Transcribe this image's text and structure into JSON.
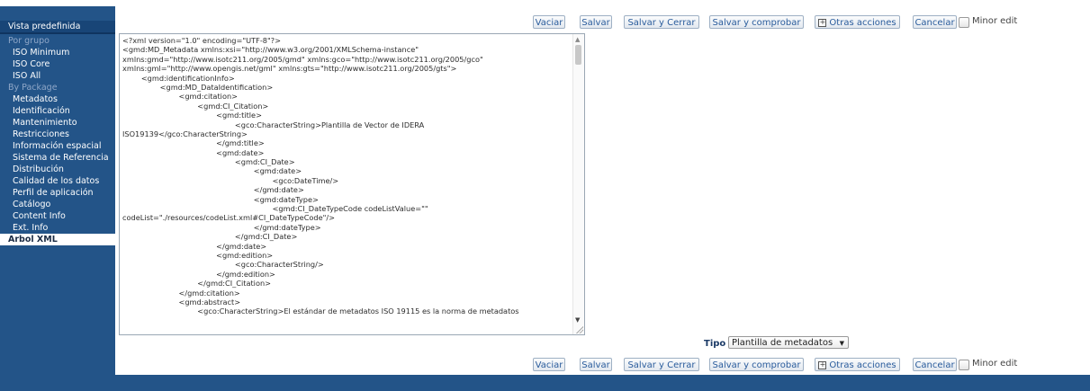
{
  "sidebar": {
    "top_item": "Vista predefinida",
    "group_header": "Por grupo",
    "group_items": [
      "ISO Minimum",
      "ISO Core",
      "ISO All"
    ],
    "package_header": "By Package",
    "package_items": [
      "Metadatos",
      "Identificación",
      "Mantenimiento",
      "Restricciones",
      "Información espacial",
      "Sistema de Referencia",
      "Distribución",
      "Calidad de los datos",
      "Perfil de aplicación",
      "Catálogo",
      "Content Info",
      "Ext. Info"
    ],
    "active_item": "Arbol XML"
  },
  "toolbar": {
    "vaciar": "Vaciar",
    "salvar": "Salvar",
    "salvar_cerrar": "Salvar y Cerrar",
    "salvar_comprobar": "Salvar y comprobar",
    "otras_acciones": "Otras acciones",
    "cancelar": "Cancelar",
    "minor_edit": "Minor edit"
  },
  "xml_lines": [
    "<?xml version=\"1.0\" encoding=\"UTF-8\"?>",
    "<gmd:MD_Metadata xmlns:xsi=\"http://www.w3.org/2001/XMLSchema-instance\"",
    "xmlns:gmd=\"http://www.isotc211.org/2005/gmd\" xmlns:gco=\"http://www.isotc211.org/2005/gco\"",
    "xmlns:gml=\"http://www.opengis.net/gml\" xmlns:gts=\"http://www.isotc211.org/2005/gts\">",
    "        <gmd:identificationInfo>",
    "                <gmd:MD_DataIdentification>",
    "                        <gmd:citation>",
    "                                <gmd:CI_Citation>",
    "                                        <gmd:title>",
    "                                                <gco:CharacterString>Plantilla de Vector de IDERA",
    "ISO19139</gco:CharacterString>",
    "                                        </gmd:title>",
    "                                        <gmd:date>",
    "                                                <gmd:CI_Date>",
    "                                                        <gmd:date>",
    "                                                                <gco:DateTime/>",
    "                                                        </gmd:date>",
    "                                                        <gmd:dateType>",
    "                                                                <gmd:CI_DateTypeCode codeListValue=\"\"",
    "codeList=\"./resources/codeList.xml#CI_DateTypeCode\"/>",
    "                                                        </gmd:dateType>",
    "                                                </gmd:CI_Date>",
    "                                        </gmd:date>",
    "                                        <gmd:edition>",
    "                                                <gco:CharacterString/>",
    "                                        </gmd:edition>",
    "                                </gmd:CI_Citation>",
    "                        </gmd:citation>",
    "                        <gmd:abstract>",
    "                                <gco:CharacterString>El estándar de metadatos ISO 19115 es la norma de metadatos"
  ],
  "tipo": {
    "label": "Tipo",
    "selected": "Plantilla de metadatos"
  }
}
